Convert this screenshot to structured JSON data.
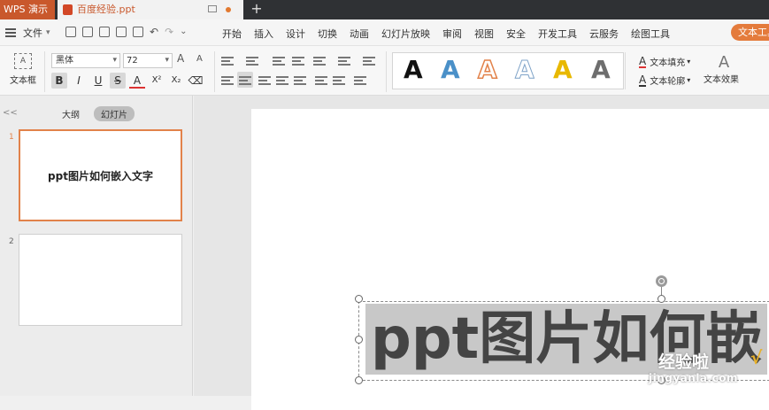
{
  "titlebar": {
    "app_tab": "WPS 演示",
    "doc_tab": "百度经验.ppt",
    "new_tab": "+"
  },
  "menubar": {
    "file_label": "文件",
    "tabs": [
      "开始",
      "插入",
      "设计",
      "切换",
      "动画",
      "幻灯片放映",
      "审阅",
      "视图",
      "安全",
      "开发工具",
      "云服务",
      "绘图工具"
    ],
    "active_tab": "文本工具"
  },
  "ribbon": {
    "textbox_label": "文本框",
    "textbox_icon_text": "A",
    "font_name": "黑体",
    "font_size": "72",
    "grow_label": "A",
    "shrink_label": "A",
    "bold": "B",
    "italic": "I",
    "underline": "U",
    "strike": "S",
    "font_color": "A",
    "superscript": "X²",
    "subscript": "X₂",
    "text_fill_label": "文本填充",
    "text_outline_label": "文本轮廓",
    "text_effect_label": "文本效果",
    "effect_glyph": "A",
    "style_glyph": "A",
    "style_colors": [
      "#111111",
      "#4a90c8",
      "#e2824a",
      "#7fa3c8",
      "#e8b800",
      "#6e6e6e"
    ]
  },
  "left_pane": {
    "collapse_label": "<<",
    "tab_outline": "大纲",
    "tab_slides": "幻灯片",
    "slides": [
      {
        "number": "1",
        "title": "ppt图片如何嵌入文字"
      },
      {
        "number": "2",
        "title": ""
      }
    ]
  },
  "canvas": {
    "selected_text": "ppt图片如何嵌",
    "watermark_main": "经验啦",
    "watermark_url": "jingyanla.com",
    "watermark_check": "√"
  }
}
